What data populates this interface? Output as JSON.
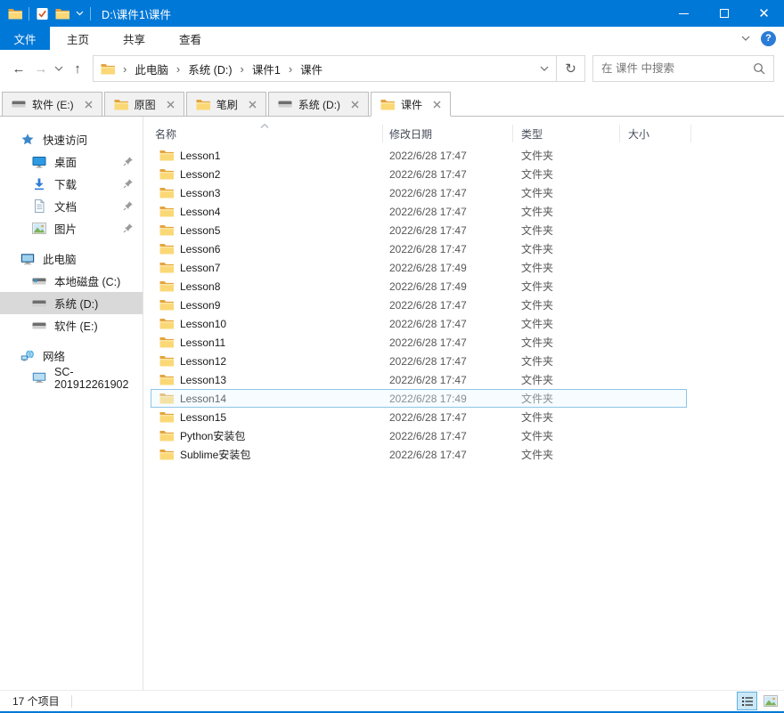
{
  "window": {
    "title": "D:\\课件1\\课件"
  },
  "icons": {
    "back_glyph": "←",
    "forward_glyph": "→",
    "up_glyph": "↑",
    "refresh_glyph": "↻",
    "breadcrumb_separator": "›",
    "help_glyph": "?"
  },
  "ribbon": {
    "file_tab": "文件",
    "tabs": [
      "主页",
      "共享",
      "查看"
    ]
  },
  "address_bar": {
    "breadcrumb": [
      "此电脑",
      "系统 (D:)",
      "课件1",
      "课件"
    ],
    "search_placeholder": "在 课件 中搜索"
  },
  "tab_bar": {
    "tabs": [
      {
        "label": "软件 (E:)",
        "icon": "drive",
        "active": false
      },
      {
        "label": "原图",
        "icon": "folder",
        "active": false
      },
      {
        "label": "笔刷",
        "icon": "folder",
        "active": false
      },
      {
        "label": "系统 (D:)",
        "icon": "drive",
        "active": false
      },
      {
        "label": "课件",
        "icon": "folder",
        "active": true
      }
    ]
  },
  "sidebar": {
    "sections": [
      {
        "label": "快速访问",
        "icon": "star",
        "items": [
          {
            "label": "桌面",
            "icon": "desktop",
            "pinned": true,
            "selected": false
          },
          {
            "label": "下载",
            "icon": "download",
            "pinned": true,
            "selected": false
          },
          {
            "label": "文档",
            "icon": "document",
            "pinned": true,
            "selected": false
          },
          {
            "label": "图片",
            "icon": "pictures",
            "pinned": true,
            "selected": false
          }
        ]
      },
      {
        "label": "此电脑",
        "icon": "computer",
        "items": [
          {
            "label": "本地磁盘 (C:)",
            "icon": "drive-c",
            "pinned": false,
            "selected": false
          },
          {
            "label": "系统 (D:)",
            "icon": "drive",
            "pinned": false,
            "selected": true
          },
          {
            "label": "软件 (E:)",
            "icon": "drive",
            "pinned": false,
            "selected": false
          }
        ]
      },
      {
        "label": "网络",
        "icon": "network",
        "items": [
          {
            "label": "SC-201912261902",
            "icon": "pc",
            "pinned": false,
            "selected": false
          }
        ]
      }
    ]
  },
  "file_list": {
    "columns": [
      "名称",
      "修改日期",
      "类型",
      "大小"
    ],
    "rows": [
      {
        "name": "Lesson1",
        "date": "2022/6/28 17:47",
        "type": "文件夹",
        "size": "",
        "selected": false
      },
      {
        "name": "Lesson2",
        "date": "2022/6/28 17:47",
        "type": "文件夹",
        "size": "",
        "selected": false
      },
      {
        "name": "Lesson3",
        "date": "2022/6/28 17:47",
        "type": "文件夹",
        "size": "",
        "selected": false
      },
      {
        "name": "Lesson4",
        "date": "2022/6/28 17:47",
        "type": "文件夹",
        "size": "",
        "selected": false
      },
      {
        "name": "Lesson5",
        "date": "2022/6/28 17:47",
        "type": "文件夹",
        "size": "",
        "selected": false
      },
      {
        "name": "Lesson6",
        "date": "2022/6/28 17:47",
        "type": "文件夹",
        "size": "",
        "selected": false
      },
      {
        "name": "Lesson7",
        "date": "2022/6/28 17:49",
        "type": "文件夹",
        "size": "",
        "selected": false
      },
      {
        "name": "Lesson8",
        "date": "2022/6/28 17:49",
        "type": "文件夹",
        "size": "",
        "selected": false
      },
      {
        "name": "Lesson9",
        "date": "2022/6/28 17:47",
        "type": "文件夹",
        "size": "",
        "selected": false
      },
      {
        "name": "Lesson10",
        "date": "2022/6/28 17:47",
        "type": "文件夹",
        "size": "",
        "selected": false
      },
      {
        "name": "Lesson11",
        "date": "2022/6/28 17:47",
        "type": "文件夹",
        "size": "",
        "selected": false
      },
      {
        "name": "Lesson12",
        "date": "2022/6/28 17:47",
        "type": "文件夹",
        "size": "",
        "selected": false
      },
      {
        "name": "Lesson13",
        "date": "2022/6/28 17:47",
        "type": "文件夹",
        "size": "",
        "selected": false
      },
      {
        "name": "Lesson14",
        "date": "2022/6/28 17:49",
        "type": "文件夹",
        "size": "",
        "selected": true
      },
      {
        "name": "Lesson15",
        "date": "2022/6/28 17:47",
        "type": "文件夹",
        "size": "",
        "selected": false
      },
      {
        "name": "Python安装包",
        "date": "2022/6/28 17:47",
        "type": "文件夹",
        "size": "",
        "selected": false
      },
      {
        "name": "Sublime安装包",
        "date": "2022/6/28 17:47",
        "type": "文件夹",
        "size": "",
        "selected": false
      }
    ]
  },
  "status_bar": {
    "item_count": "17 个项目"
  }
}
